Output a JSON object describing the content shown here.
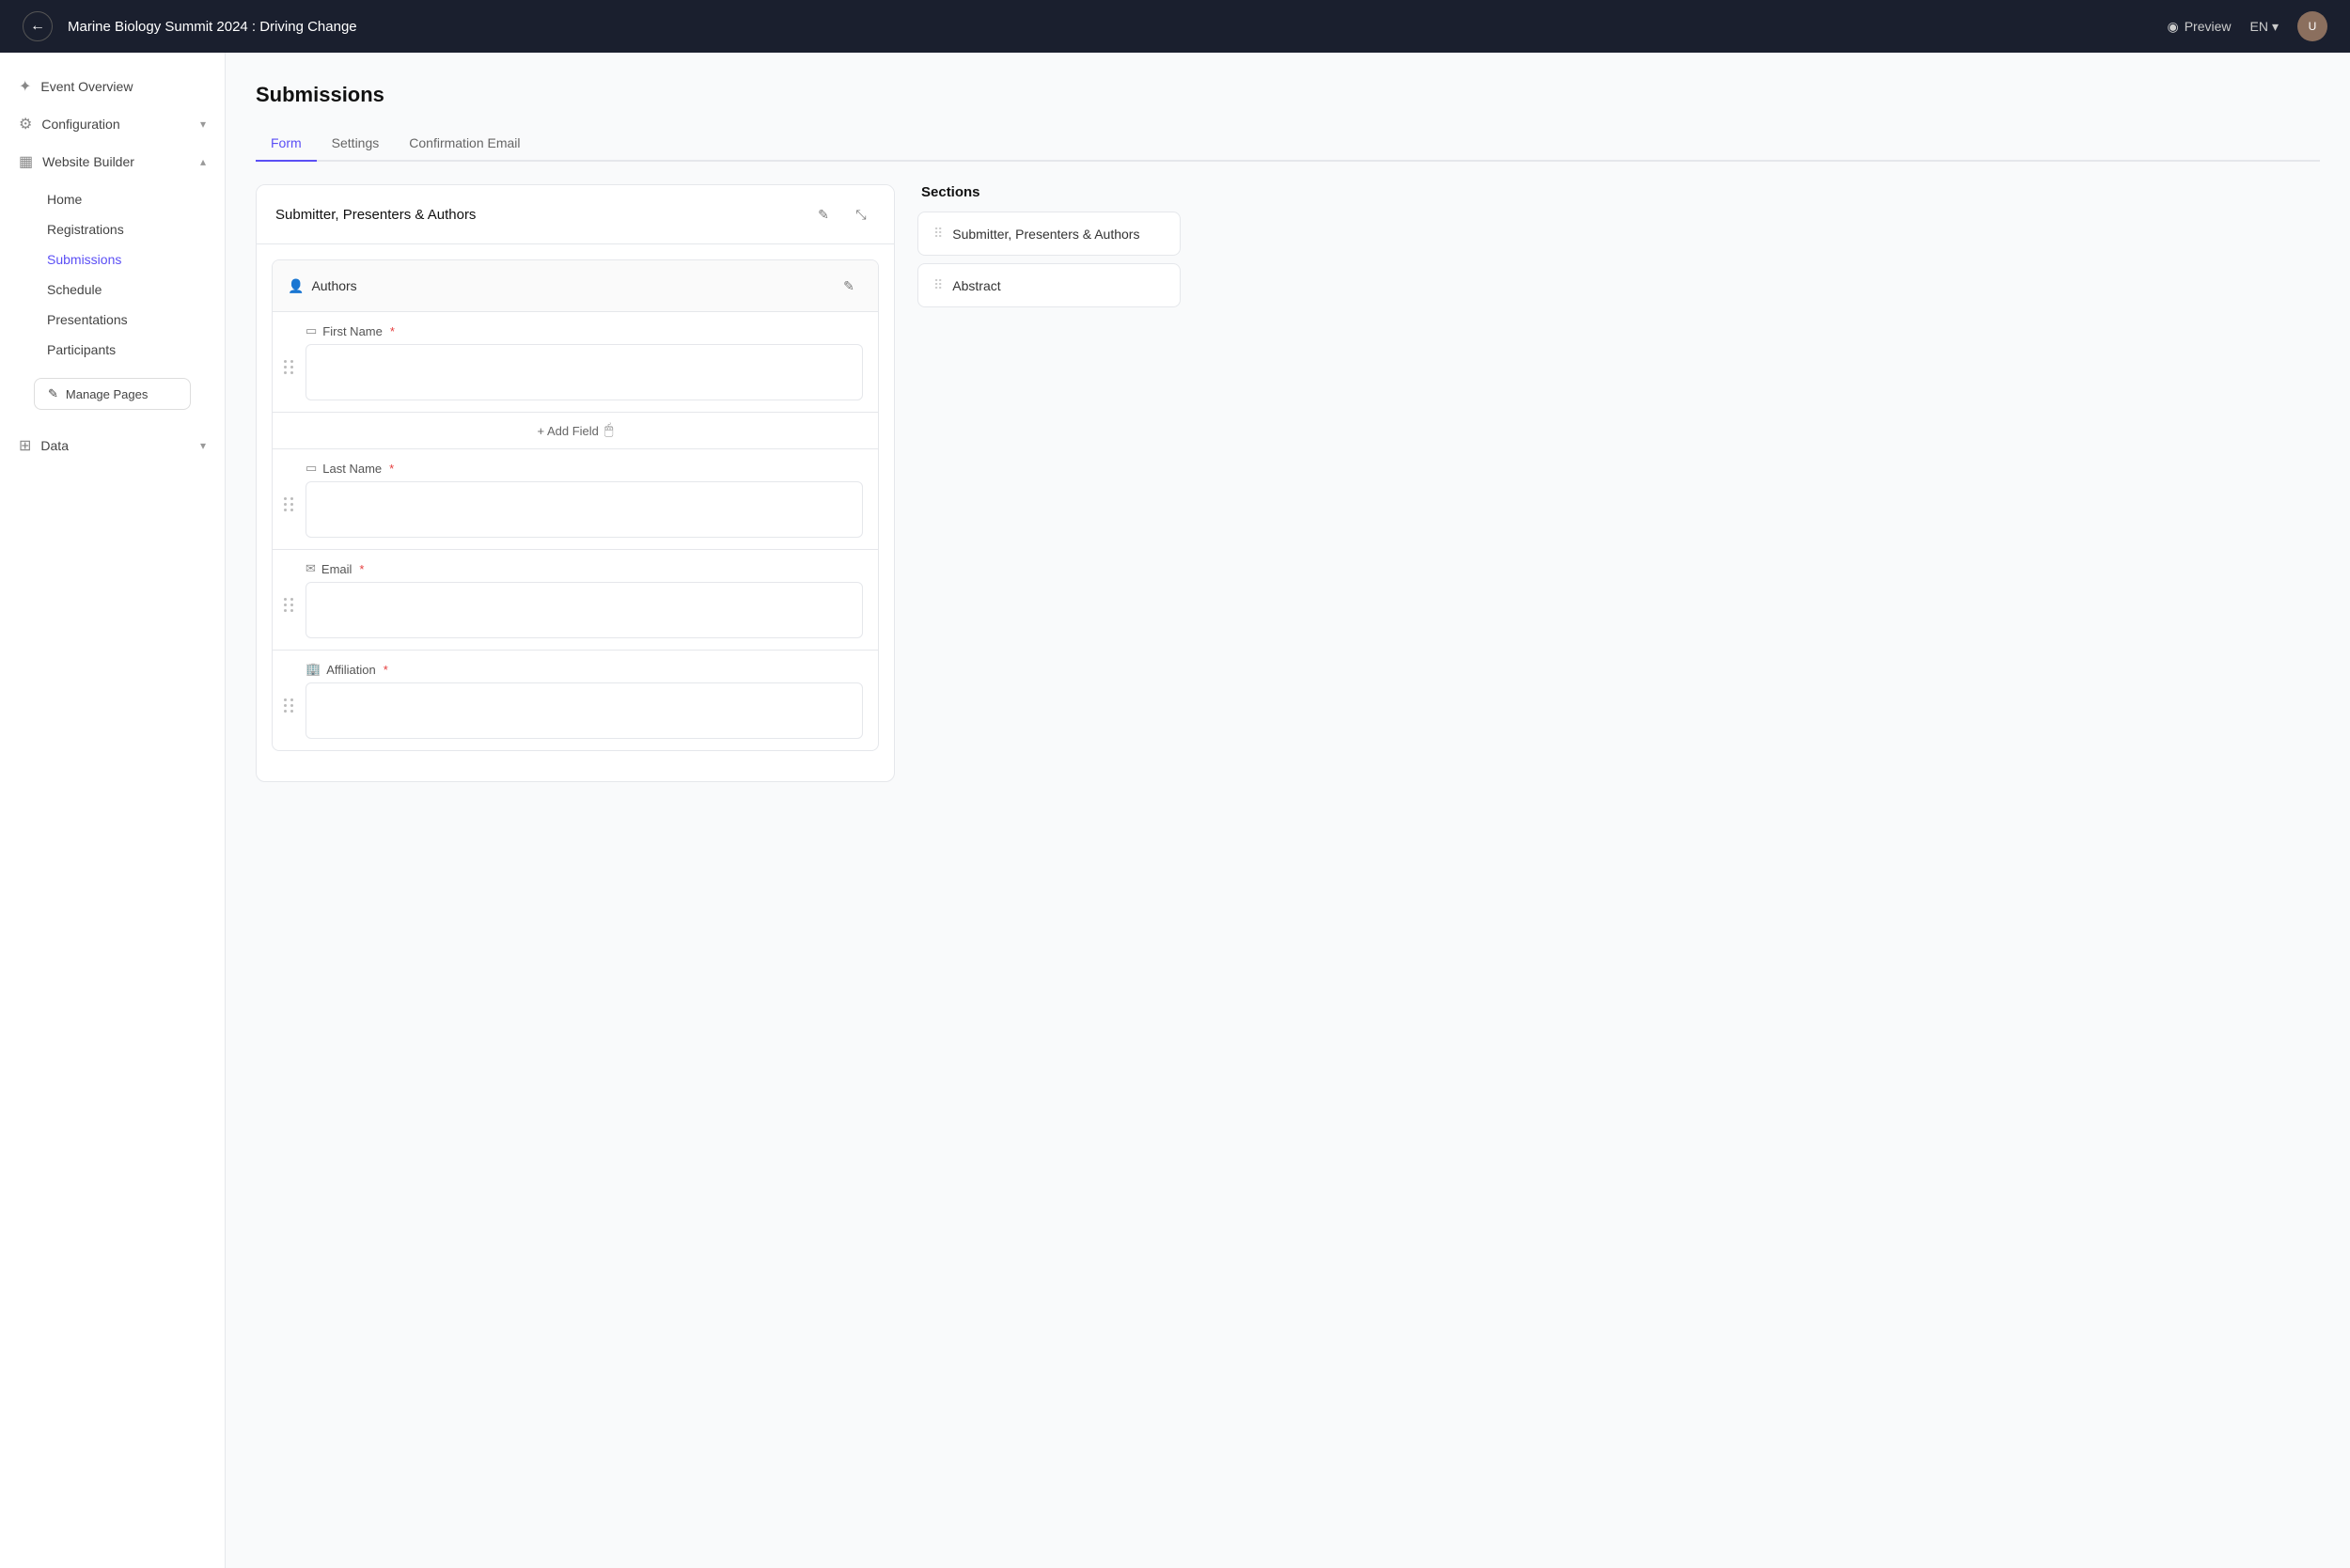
{
  "topnav": {
    "back_label": "←",
    "title": "Marine Biology Summit 2024 : Driving Change",
    "preview_label": "Preview",
    "lang_label": "EN",
    "chevron": "▾"
  },
  "sidebar": {
    "items": [
      {
        "id": "event-overview",
        "label": "Event Overview",
        "icon": "⚙",
        "iconName": "event-overview-icon",
        "hasChevron": false
      },
      {
        "id": "configuration",
        "label": "Configuration",
        "icon": "⚙",
        "iconName": "configuration-icon",
        "hasChevron": true,
        "expanded": true
      },
      {
        "id": "website-builder",
        "label": "Website Builder",
        "icon": "□",
        "iconName": "website-builder-icon",
        "hasChevron": true,
        "expanded": true
      }
    ],
    "website_sub_items": [
      {
        "id": "home",
        "label": "Home",
        "active": false
      },
      {
        "id": "registrations",
        "label": "Registrations",
        "active": false
      },
      {
        "id": "submissions",
        "label": "Submissions",
        "active": true
      },
      {
        "id": "schedule",
        "label": "Schedule",
        "active": false
      },
      {
        "id": "presentations",
        "label": "Presentations",
        "active": false
      },
      {
        "id": "participants",
        "label": "Participants",
        "active": false
      }
    ],
    "manage_pages_label": "Manage Pages",
    "data_label": "Data",
    "data_icon": "□"
  },
  "main": {
    "page_title": "Submissions",
    "tabs": [
      {
        "id": "form",
        "label": "Form",
        "active": true
      },
      {
        "id": "settings",
        "label": "Settings",
        "active": false
      },
      {
        "id": "confirmation-email",
        "label": "Confirmation Email",
        "active": false
      }
    ],
    "section_card": {
      "title": "Submitter, Presenters & Authors"
    },
    "authors_block": {
      "title": "Authors"
    },
    "fields": [
      {
        "id": "first-name",
        "label": "First Name",
        "required": true,
        "icon": "▭",
        "iconName": "text-field-icon"
      },
      {
        "id": "last-name",
        "label": "Last Name",
        "required": true,
        "icon": "▭",
        "iconName": "text-field-icon"
      },
      {
        "id": "email",
        "label": "Email",
        "required": true,
        "icon": "✉",
        "iconName": "email-field-icon"
      },
      {
        "id": "affiliation",
        "label": "Affiliation",
        "required": true,
        "icon": "🏢",
        "iconName": "affiliation-field-icon"
      }
    ],
    "add_field_label": "+ Add Field",
    "sections_panel": {
      "title": "Sections",
      "items": [
        {
          "id": "submitter-presenters-authors",
          "label": "Submitter, Presenters & Authors"
        },
        {
          "id": "abstract",
          "label": "Abstract"
        }
      ]
    }
  }
}
